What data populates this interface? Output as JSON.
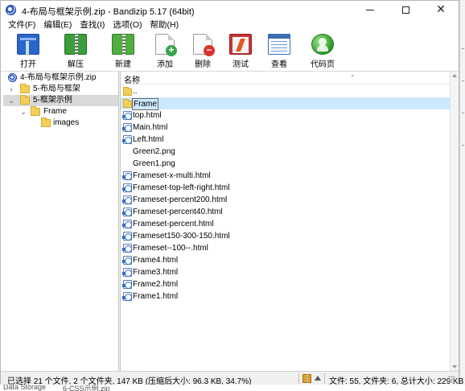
{
  "window": {
    "title": "4-布局与框架示例.zip - Bandizip 5.17 (64bit)",
    "controls": [
      "minimize",
      "maximize",
      "close"
    ]
  },
  "menu": [
    "文件(F)",
    "编辑(E)",
    "查找(I)",
    "选项(O)",
    "帮助(H)"
  ],
  "toolbar": [
    {
      "label": "打开",
      "icon": "open-icon",
      "has_dropdown": true
    },
    {
      "label": "解压",
      "icon": "extract-icon",
      "has_dropdown": true
    },
    {
      "label": "新建",
      "icon": "new-archive-icon",
      "has_dropdown": false
    },
    {
      "label": "添加",
      "icon": "add-file-icon",
      "has_dropdown": false
    },
    {
      "label": "删除",
      "icon": "delete-file-icon",
      "has_dropdown": false
    },
    {
      "label": "测试",
      "icon": "test-icon",
      "has_dropdown": false
    },
    {
      "label": "查看",
      "icon": "view-icon",
      "has_dropdown": false
    },
    {
      "label": "代码页",
      "icon": "codepage-icon",
      "has_dropdown": false
    }
  ],
  "tree": [
    {
      "label": "4-布局与框架示例.zip",
      "type": "archive",
      "expander": ""
    },
    {
      "label": "5-布局与框架",
      "type": "folder",
      "expander": "›"
    },
    {
      "label": "5-框架示例",
      "type": "folder",
      "expander": "⌄",
      "selected": true
    },
    {
      "label": "Frame",
      "type": "folder",
      "expander": "⌄"
    },
    {
      "label": "images",
      "type": "folder",
      "expander": ""
    }
  ],
  "list": {
    "column_header": "名称",
    "items": [
      {
        "name": "..",
        "type": "folder"
      },
      {
        "name": "Frame",
        "type": "folder",
        "selected": true
      },
      {
        "name": "top.html",
        "type": "html"
      },
      {
        "name": "Main.html",
        "type": "html"
      },
      {
        "name": "Left.html",
        "type": "html"
      },
      {
        "name": "Green2.png",
        "type": "png"
      },
      {
        "name": "Green1.png",
        "type": "png"
      },
      {
        "name": "Frameset-x-multi.html",
        "type": "html"
      },
      {
        "name": "Frameset-top-left-right.html",
        "type": "html"
      },
      {
        "name": "Frameset-percent200.html",
        "type": "html"
      },
      {
        "name": "Frameset-percent40.html",
        "type": "html"
      },
      {
        "name": "Frameset-percent.html",
        "type": "html"
      },
      {
        "name": "Frameset150-300-150.html",
        "type": "html"
      },
      {
        "name": "Frameset--100--.html",
        "type": "html"
      },
      {
        "name": "Frame4.html",
        "type": "html"
      },
      {
        "name": "Frame3.html",
        "type": "html"
      },
      {
        "name": "Frame2.html",
        "type": "html"
      },
      {
        "name": "Frame1.html",
        "type": "html"
      }
    ]
  },
  "status": {
    "selection": "已选择 21 个文件, 2 个文件夹, 147 KB (压缩后大小: 96.3 KB, 34.7%)",
    "totals": "文件: 55, 文件夹: 6, 总计大小: 229 KB"
  },
  "taskbar_peek": {
    "left": "Data Storage",
    "right": "6-CSS示例.zip"
  }
}
